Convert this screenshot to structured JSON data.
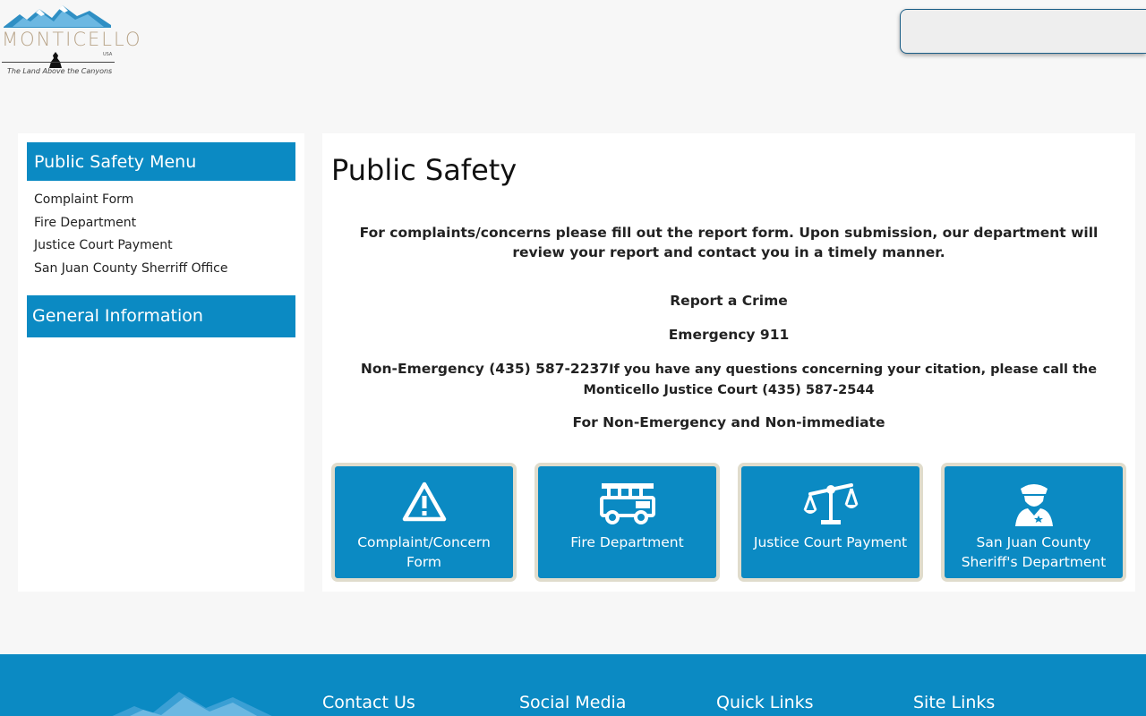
{
  "header": {
    "logo_name": "MONTICELLO",
    "logo_country": "USA",
    "logo_tagline": "The Land Above the Canyons",
    "search_placeholder": ""
  },
  "sidebar": {
    "menu_heading": "Public Safety Menu",
    "items": [
      {
        "label": "Complaint Form"
      },
      {
        "label": "Fire Department"
      },
      {
        "label": "Justice Court Payment"
      },
      {
        "label": "San Juan County Sherriff Office"
      }
    ],
    "general_heading": "General Information"
  },
  "main": {
    "title": "Public Safety",
    "intro": "For complaints/concerns please fill out the report form. Upon submission, our department will review your report and contact you in a timely manner.",
    "report": "Report a Crime",
    "emergency": "Emergency 911",
    "non_emergency": "Non-Emergency (435) 587-2237",
    "citation": "If you have any questions concerning your citation, please call the Monticello Justice Court (435) 587-2544",
    "non_immediate": "For Non-Emergency and Non-immediate",
    "cards": [
      {
        "label": "Complaint/Concern Form",
        "icon": "warning-icon"
      },
      {
        "label": "Fire Department",
        "icon": "fire-truck-icon"
      },
      {
        "label": "Justice Court Payment",
        "icon": "scales-icon"
      },
      {
        "label": "San Juan County Sheriff's Department",
        "icon": "police-officer-icon"
      }
    ]
  },
  "footer": {
    "headings": [
      "Contact Us",
      "Social Media",
      "Quick Links",
      "Site Links"
    ]
  },
  "colors": {
    "accent": "#0b8ac3",
    "card_border": "#e0dccc",
    "page_bg": "#f7f7f7"
  }
}
